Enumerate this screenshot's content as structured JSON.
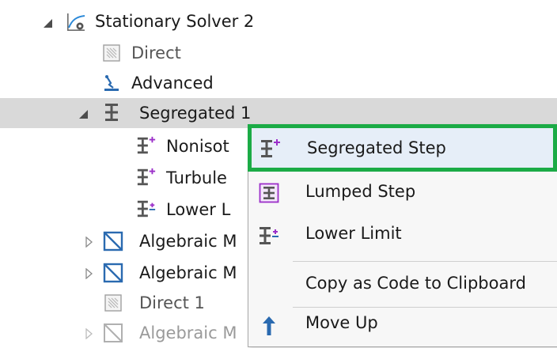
{
  "tree": {
    "stationary_solver": "Stationary Solver 2",
    "direct": "Direct",
    "advanced": "Advanced",
    "segregated": "Segregated 1",
    "child_nonisot": "Nonisot",
    "child_turbule": "Turbule",
    "child_lower": "Lower L",
    "algebraic_1": "Algebraic M",
    "algebraic_2": "Algebraic M",
    "direct_1": "Direct 1",
    "algebraic_3": "Algebraic M"
  },
  "context_menu": {
    "items": [
      {
        "label": "Segregated Step",
        "icon": "segregated-step-icon"
      },
      {
        "label": "Lumped Step",
        "icon": "lumped-step-icon"
      },
      {
        "label": "Lower Limit",
        "icon": "lower-limit-icon"
      },
      {
        "label": "Copy as Code to Clipboard",
        "icon": ""
      },
      {
        "label": "Move Up",
        "icon": "arrow-up-icon"
      }
    ]
  },
  "colors": {
    "highlight": "#1bab46",
    "selection": "#d9d9d9",
    "step_purple": "#9b2fc9",
    "solver_blue": "#2a6ab0"
  }
}
